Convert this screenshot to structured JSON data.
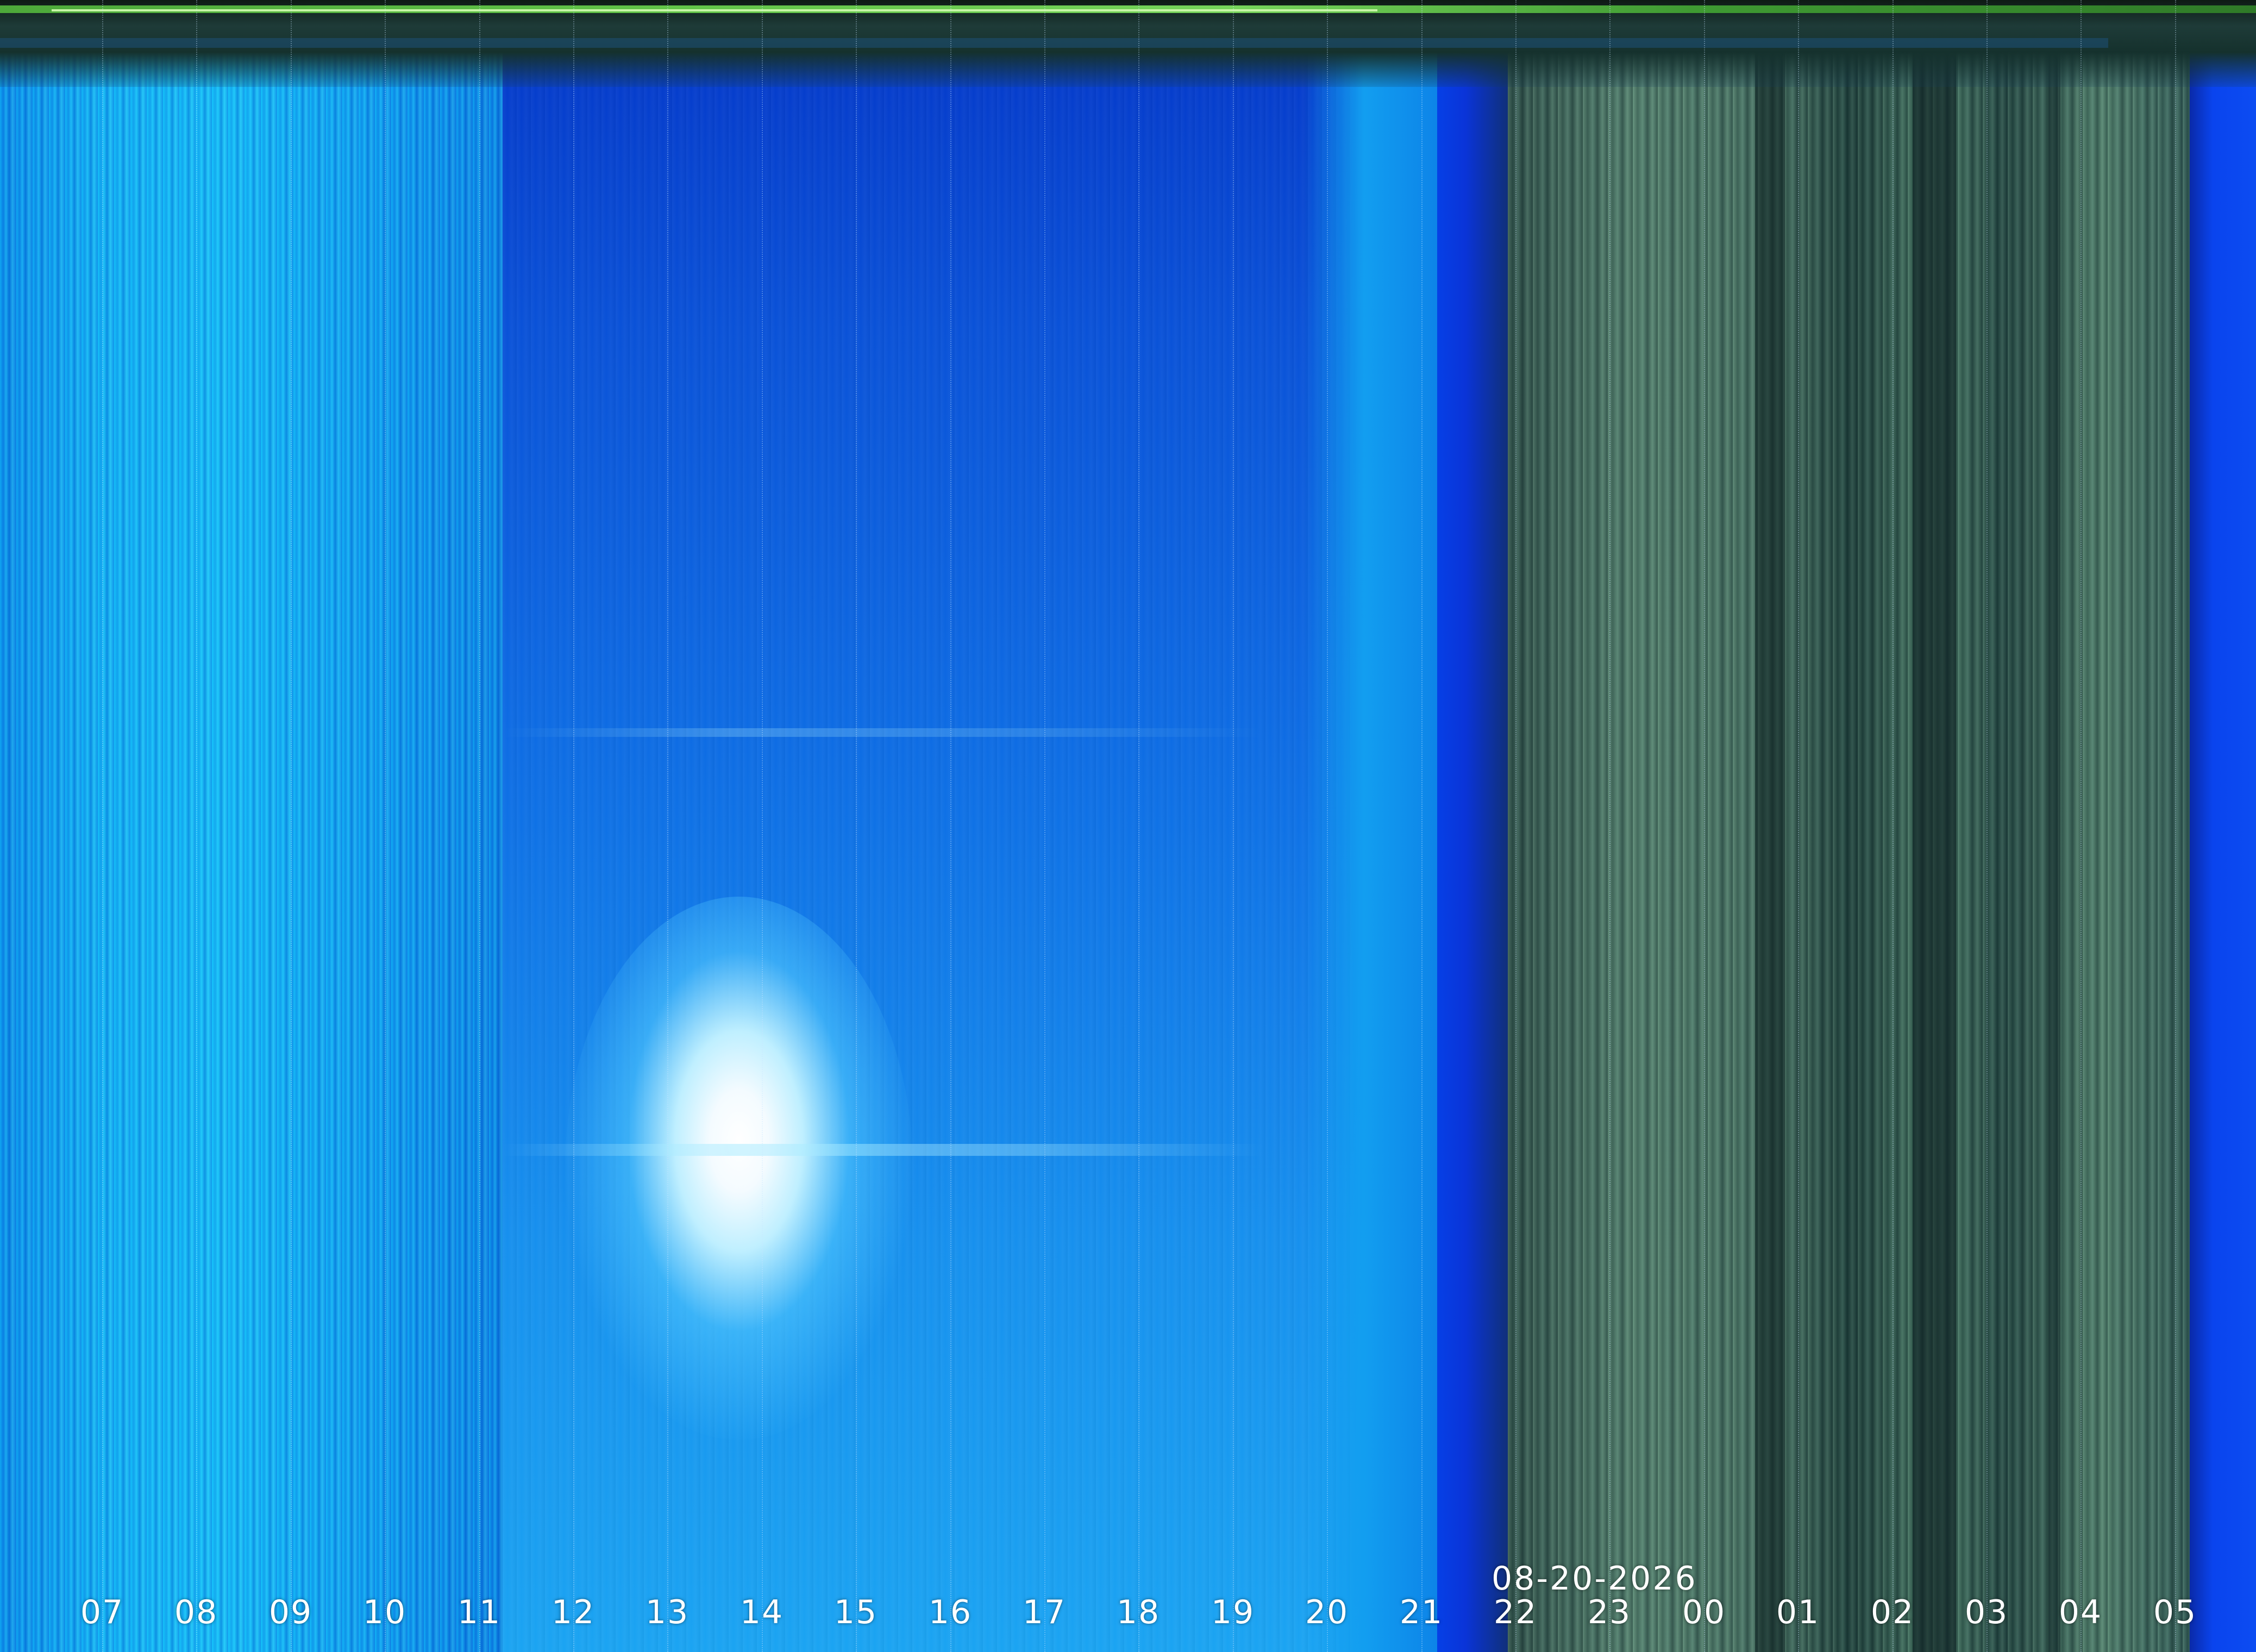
{
  "keogram": {
    "date": "08-20-2026",
    "hours": [
      "07",
      "08",
      "09",
      "10",
      "11",
      "12",
      "13",
      "14",
      "15",
      "16",
      "17",
      "18",
      "19",
      "20",
      "21",
      "22",
      "23",
      "00",
      "01",
      "02",
      "03",
      "04",
      "05"
    ]
  },
  "colors": {
    "day_sky": "#0f72e6",
    "night_sky": "#2c4a45",
    "top_bar": "#62c448",
    "label_text": "#ffffff"
  }
}
